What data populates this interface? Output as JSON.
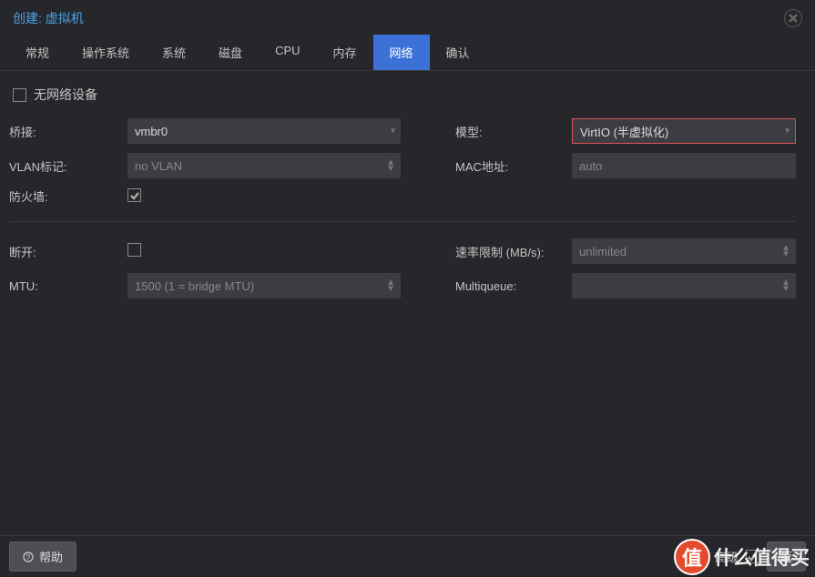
{
  "header": {
    "title": "创建: 虚拟机"
  },
  "tabs": [
    {
      "label": "常规"
    },
    {
      "label": "操作系统"
    },
    {
      "label": "系统"
    },
    {
      "label": "磁盘"
    },
    {
      "label": "CPU"
    },
    {
      "label": "内存"
    },
    {
      "label": "网络",
      "active": true
    },
    {
      "label": "确认"
    }
  ],
  "no_net": {
    "label": "无网络设备",
    "checked": false
  },
  "fields": {
    "bridge": {
      "label": "桥接:",
      "value": "vmbr0"
    },
    "vlan": {
      "label": "VLAN标记:",
      "placeholder": "no VLAN"
    },
    "firewall": {
      "label": "防火墙:",
      "checked": true
    },
    "model": {
      "label": "模型:",
      "value": "VirtIO (半虚拟化)"
    },
    "mac": {
      "label": "MAC地址:",
      "placeholder": "auto"
    },
    "disconnect": {
      "label": "断开:",
      "checked": false
    },
    "rate": {
      "label": "速率限制 (MB/s):",
      "placeholder": "unlimited"
    },
    "mtu": {
      "label": "MTU:",
      "placeholder": "1500 (1 = bridge MTU)"
    },
    "multiqueue": {
      "label": "Multiqueue:",
      "placeholder": ""
    }
  },
  "footer": {
    "help": "帮助",
    "advanced": "高级",
    "back": "返",
    "watermark": "什么值得买",
    "watermark_badge": "值"
  }
}
